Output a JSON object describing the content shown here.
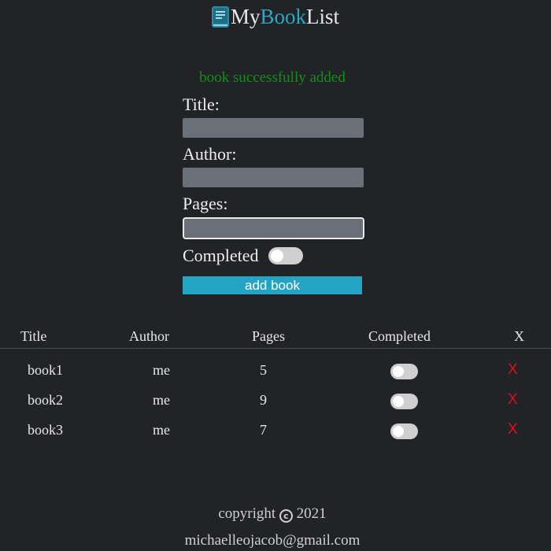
{
  "header": {
    "logo_icon": "book-icon",
    "title_part1": "My",
    "title_part2": "Book",
    "title_part3": "List",
    "accent_color": "#2aa7c4"
  },
  "form": {
    "success_message": "book successfully added",
    "title_label": "Title:",
    "title_value": "",
    "author_label": "Author:",
    "author_value": "",
    "pages_label": "Pages:",
    "pages_value": "",
    "completed_label": "Completed",
    "completed_checked": false,
    "submit_label": "add book"
  },
  "table": {
    "headers": {
      "title": "Title",
      "author": "Author",
      "pages": "Pages",
      "completed": "Completed",
      "delete": "X"
    },
    "rows": [
      {
        "title": "book1",
        "author": "me",
        "pages": "5",
        "completed": false,
        "delete": "X"
      },
      {
        "title": "book2",
        "author": "me",
        "pages": "9",
        "completed": false,
        "delete": "X"
      },
      {
        "title": "book3",
        "author": "me",
        "pages": "7",
        "completed": false,
        "delete": "X"
      }
    ]
  },
  "footer": {
    "copyright_prefix": "copyright",
    "copyright_symbol": "c",
    "copyright_year": "2021",
    "email": "michaelleojacob@gmail.com"
  },
  "colors": {
    "background": "#212327",
    "success": "#0f9115",
    "button": "#23a4c4",
    "delete": "#d9121c",
    "input": "#6b6f77"
  }
}
